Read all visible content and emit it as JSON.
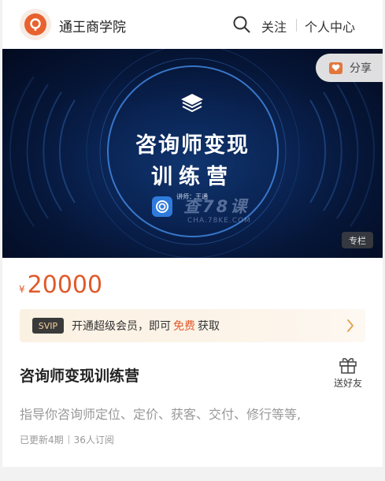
{
  "header": {
    "brand": "通王商学院",
    "follow_label": "关注",
    "user_center_label": "个人中心"
  },
  "banner": {
    "title_line1": "咨询师变现",
    "title_line2": "训练营",
    "lecturer": "讲师：王通",
    "watermark_main": "查78课",
    "watermark_url": "CHA.78KE.COM",
    "share_label": "分享",
    "type_badge": "专栏"
  },
  "price": {
    "currency": "¥",
    "amount": "20000"
  },
  "svip": {
    "tag": "SVIP",
    "text": "开通超级会员，即可",
    "free": "免费",
    "get": "获取"
  },
  "course": {
    "title": "咨询师变现训练营",
    "gift_label": "送好友",
    "description": "指导你咨询师定位、定价、获客、交付、修行等等,",
    "updated": "已更新4期",
    "subscribers": "36人订阅"
  },
  "colors": {
    "accent": "#e05a2a",
    "banner_bg": "#061638",
    "svip_bg": "#fbf1e3"
  },
  "icons": [
    "logo-icon",
    "search-icon",
    "share-icon",
    "stack-icon",
    "app-icon",
    "chevron-right-icon",
    "gift-icon"
  ]
}
